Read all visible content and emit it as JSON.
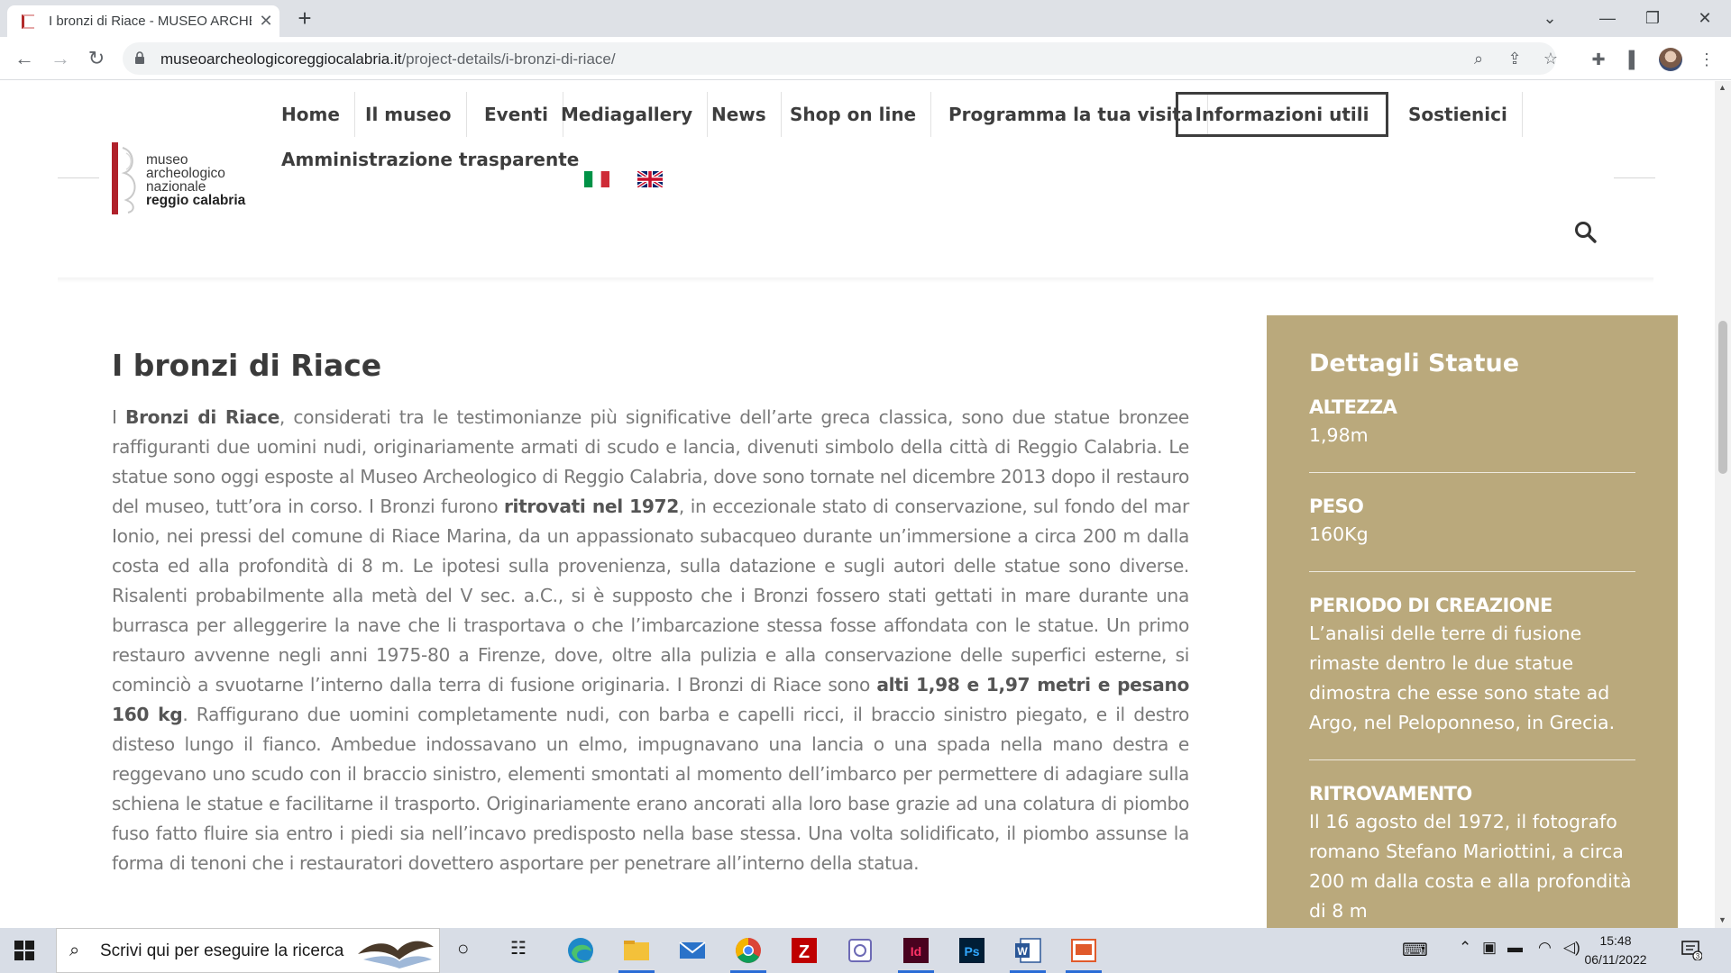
{
  "browser": {
    "tab_title": "I bronzi di Riace - MUSEO ARCHEOLOGICO",
    "url_host": "museoarcheologicoreggiocalabria.it",
    "url_path": "/project-details/i-bronzi-di-riace/"
  },
  "logo": {
    "line1": "museo",
    "line2": "archeologico",
    "line3": "nazionale",
    "line4": "reggio calabria"
  },
  "menu": {
    "items": [
      "Home",
      "Il museo",
      "Eventi",
      "Mediagallery",
      "News",
      "Shop on line",
      "Programma la tua visita",
      "Informazioni utili",
      "Sostienici"
    ],
    "row2": "Amministrazione trasparente",
    "active": "Informazioni utili"
  },
  "article": {
    "title": "I bronzi di Riace",
    "p_intro": "I ",
    "p_b1": "Bronzi di Riace",
    "p_t1": ", considerati tra le testimonianze più significative dell’arte greca classica, sono due statue bronzee raffiguranti due uomini nudi, originariamente armati di scudo e lancia, divenuti simbolo della città di Reggio Calabria. Le statue sono oggi esposte al Museo Archeologico di Reggio Calabria, dove sono tornate nel dicembre 2013 dopo il restauro del museo, tutt’ora in corso. I Bronzi furono ",
    "p_b2": "ritrovati nel 1972",
    "p_t2": ", in eccezionale stato di conservazione, sul fondo del mar Ionio, nei pressi del comune di Riace Marina, da un appassionato subacqueo durante un’immersione a circa 200 m dalla costa ed alla profondità di 8 m. Le ipotesi sulla provenienza, sulla datazione e sugli autori delle statue sono diverse. Risalenti probabilmente alla metà del V sec. a.C., si è supposto che i Bronzi fossero stati gettati in mare durante una burrasca per alleggerire la nave che li trasportava o che l’imbarcazione stessa fosse affondata con le statue. Un primo restauro avvenne negli anni 1975-80 a Firenze, dove, oltre alla pulizia e alla conservazione delle superfici esterne, si cominciò a svuotarne l’interno dalla terra di fusione originaria. I Bronzi di Riace sono ",
    "p_b3": "alti 1,98 e 1,97 metri e pesano 160 kg",
    "p_t3": ". Raffigurano due uomini completamente nudi, con barba e capelli ricci, il braccio sinistro piegato, e il destro disteso lungo il fianco. Ambedue indossavano un elmo, impugnavano una lancia o una spada nella mano destra e reggevano uno scudo con il braccio sinistro, elementi smontati al momento dell’imbarco per permettere di adagiare sulla schiena le statue e facilitarne il trasporto. Originariamente erano ancorati alla loro base grazie ad una colatura di piombo fuso fatto fluire sia entro i piedi sia nell’incavo predisposto nella base stessa. Una volta solidificato, il piombo assunse la forma di tenoni che i restauratori dovettero asportare per penetrare all’interno della statua."
  },
  "sidebar": {
    "title": "Dettagli Statue",
    "details": [
      {
        "label": "ALTEZZA",
        "value": "1,98m"
      },
      {
        "label": "PESO",
        "value": "160Kg"
      },
      {
        "label": "PERIODO DI CREAZIONE",
        "value": "L’analisi delle terre di fusione rimaste dentro le due statue dimostra che esse sono state ad Argo, nel Peloponneso, in Grecia."
      },
      {
        "label": "RITROVAMENTO",
        "value": "Il 16 agosto del 1972, il fotografo romano Stefano Mariottini, a circa 200 m dalla costa e alla profondità di 8 m"
      }
    ]
  },
  "taskbar": {
    "search_placeholder": "Scrivi qui per eseguire la ricerca",
    "time": "15:48",
    "date": "06/11/2022",
    "notification_count": "3"
  },
  "colors": {
    "sidebar_bg": "#baa97c",
    "logo_red": "#b0212b",
    "text_grey": "#7a7a7a"
  }
}
